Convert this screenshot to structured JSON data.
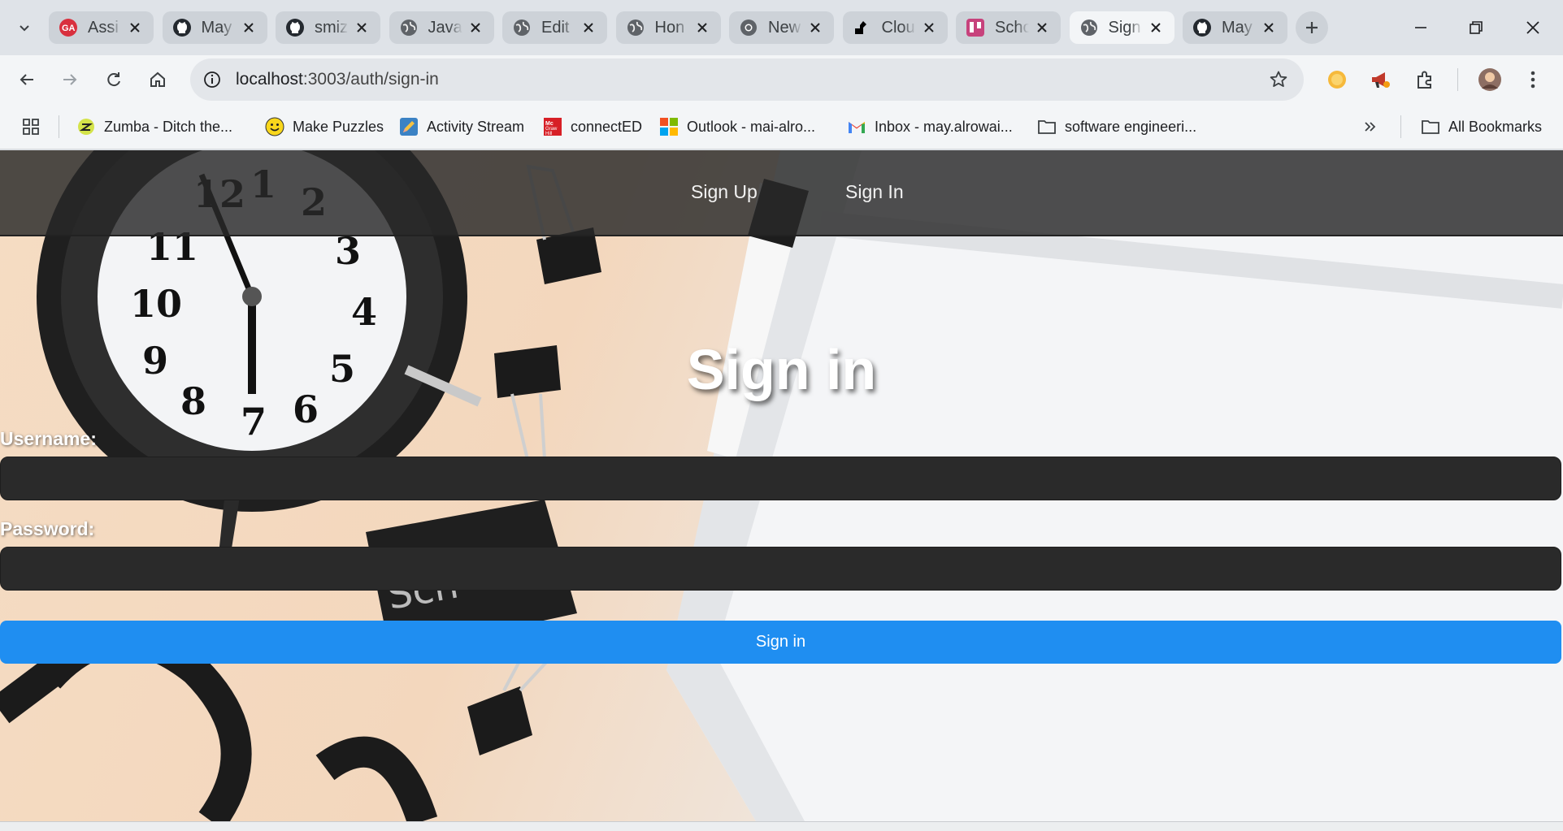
{
  "tabs": [
    {
      "title": "Assi",
      "icon": "ga-icon",
      "color": "#d9303e"
    },
    {
      "title": "May",
      "icon": "github-icon",
      "color": "#24292f"
    },
    {
      "title": "smiz",
      "icon": "github-icon",
      "color": "#24292f"
    },
    {
      "title": "Java",
      "icon": "globe-icon",
      "color": "#5f6368"
    },
    {
      "title": "Edit",
      "icon": "globe-icon",
      "color": "#5f6368"
    },
    {
      "title": "Hon",
      "icon": "globe-icon",
      "color": "#5f6368"
    },
    {
      "title": "New",
      "icon": "chrome-icon",
      "color": "#5f6368"
    },
    {
      "title": "Clou",
      "icon": "cloudinary-icon",
      "color": "#000000"
    },
    {
      "title": "Scho",
      "icon": "trello-icon",
      "color": "#c7427c"
    },
    {
      "title": "Sign",
      "icon": "globe-icon",
      "color": "#5f6368",
      "active": true
    },
    {
      "title": "May",
      "icon": "github-icon",
      "color": "#24292f"
    }
  ],
  "toolbar": {
    "url_host": "localhost",
    "url_path": ":3003/auth/sign-in"
  },
  "bookmarks": {
    "items": [
      {
        "label": "Zumba - Ditch the...",
        "icon": "zumba-icon"
      },
      {
        "label": "Make Puzzles",
        "icon": "smiley-icon"
      },
      {
        "label": "Activity Stream",
        "icon": "pencil-icon"
      },
      {
        "label": "connectED",
        "icon": "mcgraw-hill-icon"
      },
      {
        "label": "Outlook - mai-alro...",
        "icon": "microsoft-icon"
      },
      {
        "label": "Inbox - may.alrowai...",
        "icon": "gmail-icon"
      },
      {
        "label": "software engineeri...",
        "icon": "folder-icon"
      }
    ],
    "all_bookmarks": "All Bookmarks"
  },
  "page": {
    "nav": {
      "signup": "Sign Up",
      "signin": "Sign In"
    },
    "heading": "Sign in",
    "username_label": "Username:",
    "password_label": "Password:",
    "submit_label": "Sign in",
    "accent": "#1f8ef1"
  }
}
